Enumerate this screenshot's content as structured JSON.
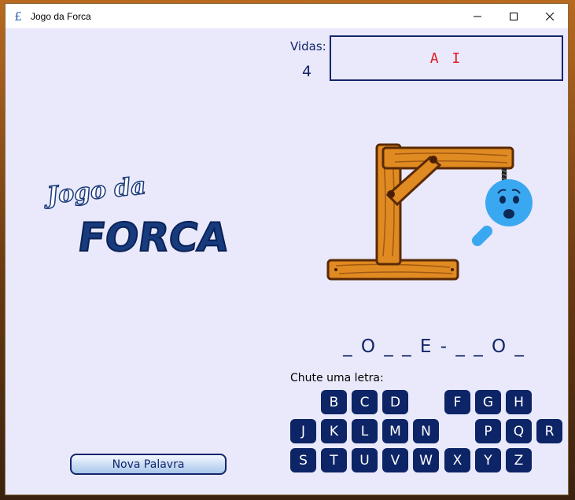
{
  "window": {
    "title": "Jogo da Forca",
    "app_icon": "£"
  },
  "logo": {
    "line1": "Jogo da",
    "line2": "FORCA"
  },
  "lives": {
    "label": "Vidas:",
    "value": "4"
  },
  "wrong_letters": "A I",
  "word": {
    "masked": "_ O _ _ E - _ _ O _"
  },
  "prompt": "Chute uma letra:",
  "keyboard": {
    "row1": [
      "B",
      "C",
      "D",
      "F",
      "G",
      "H"
    ],
    "row2": [
      "J",
      "K",
      "L",
      "M",
      "N",
      "P",
      "Q",
      "R"
    ],
    "row3": [
      "S",
      "T",
      "U",
      "V",
      "W",
      "X",
      "Y",
      "Z"
    ]
  },
  "buttons": {
    "new_word": "Nova Palavra"
  },
  "colors": {
    "navy": "#0d2466",
    "wrong": "#e01b24",
    "background": "#e9e9fb",
    "face": "#3aa8f0",
    "wood": "#e08a22"
  },
  "icons": {
    "minimize": "minimize-icon",
    "maximize": "maximize-icon",
    "close": "close-icon",
    "face": "worried-face-icon"
  }
}
